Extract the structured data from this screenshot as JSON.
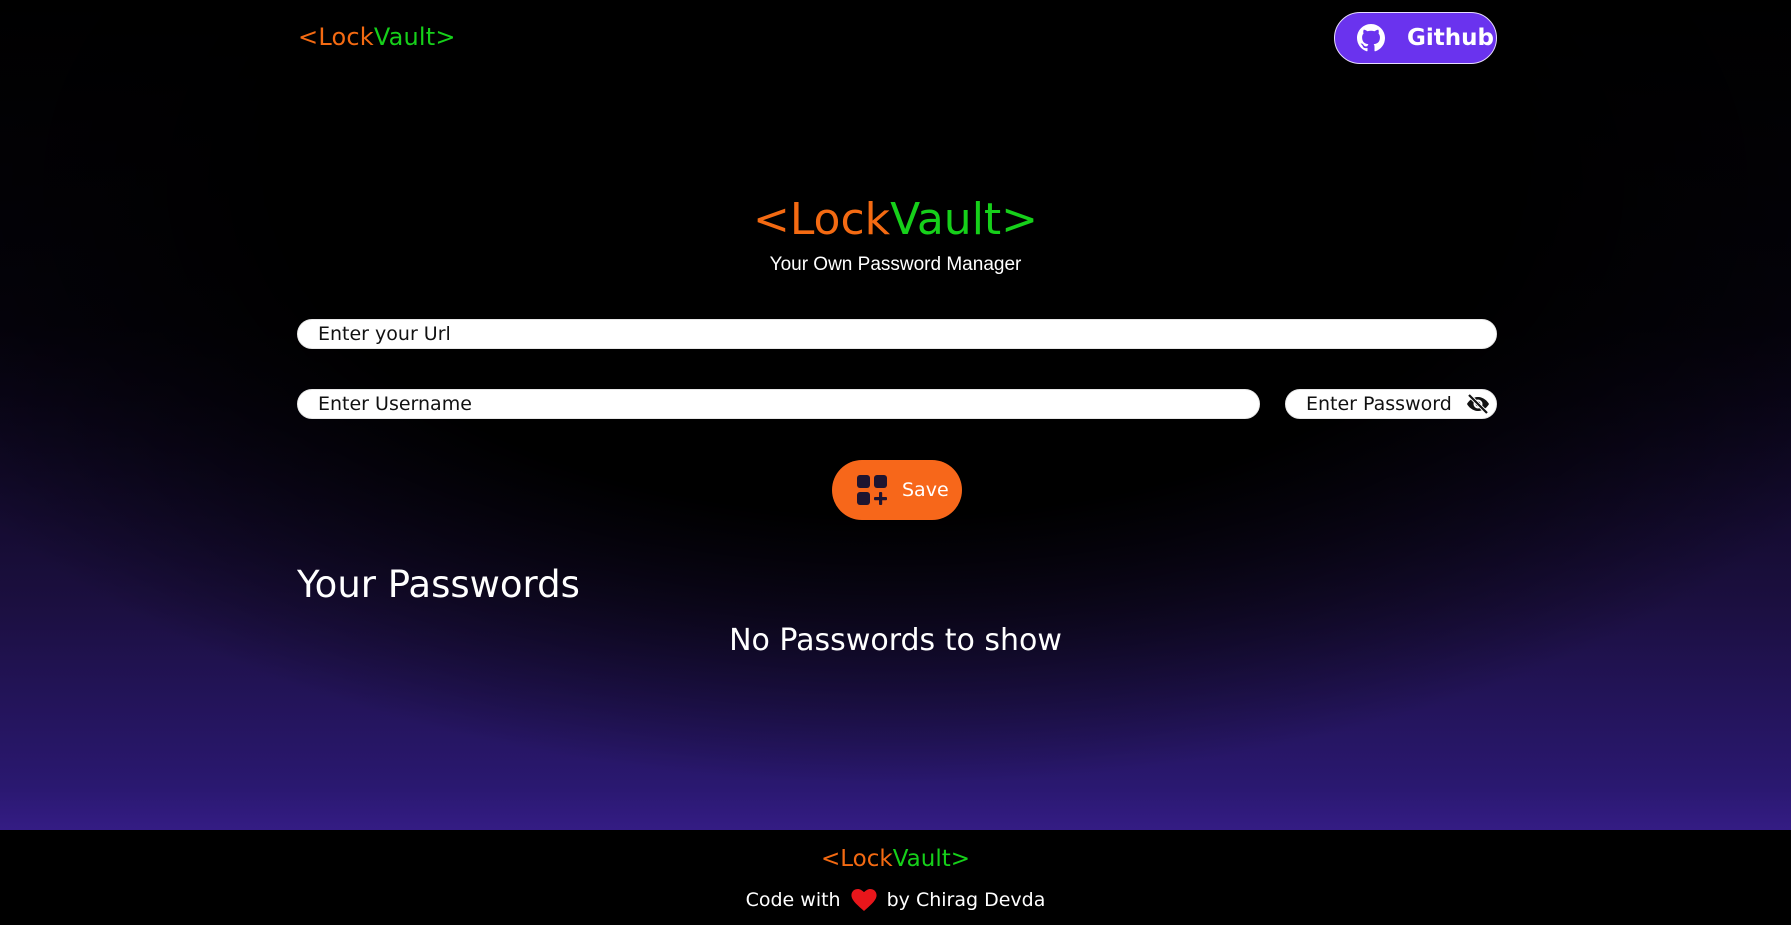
{
  "brand": {
    "open": "<",
    "lock": "Lock",
    "vault": "Vault",
    "close": ">"
  },
  "navbar": {
    "github_label": "Github"
  },
  "hero": {
    "subtitle": "Your Own Password Manager"
  },
  "form": {
    "url_placeholder": "Enter your Url",
    "username_placeholder": "Enter Username",
    "password_placeholder": "Enter Password",
    "save_label": "Save"
  },
  "passwords": {
    "title": "Your Passwords",
    "empty_message": "No Passwords to show"
  },
  "footer": {
    "credit_prefix": "Code with",
    "credit_suffix": "by Chirag Devda"
  },
  "icons": {
    "github": "github-icon",
    "eye_off": "eye-off-icon",
    "save": "add-grid-icon",
    "heart": "heart-icon"
  },
  "colors": {
    "orange": "#f46a12",
    "green": "#16d01a",
    "github_purple": "#6a33ee",
    "save_orange": "#f7671a",
    "heart_red": "#e8161b"
  }
}
